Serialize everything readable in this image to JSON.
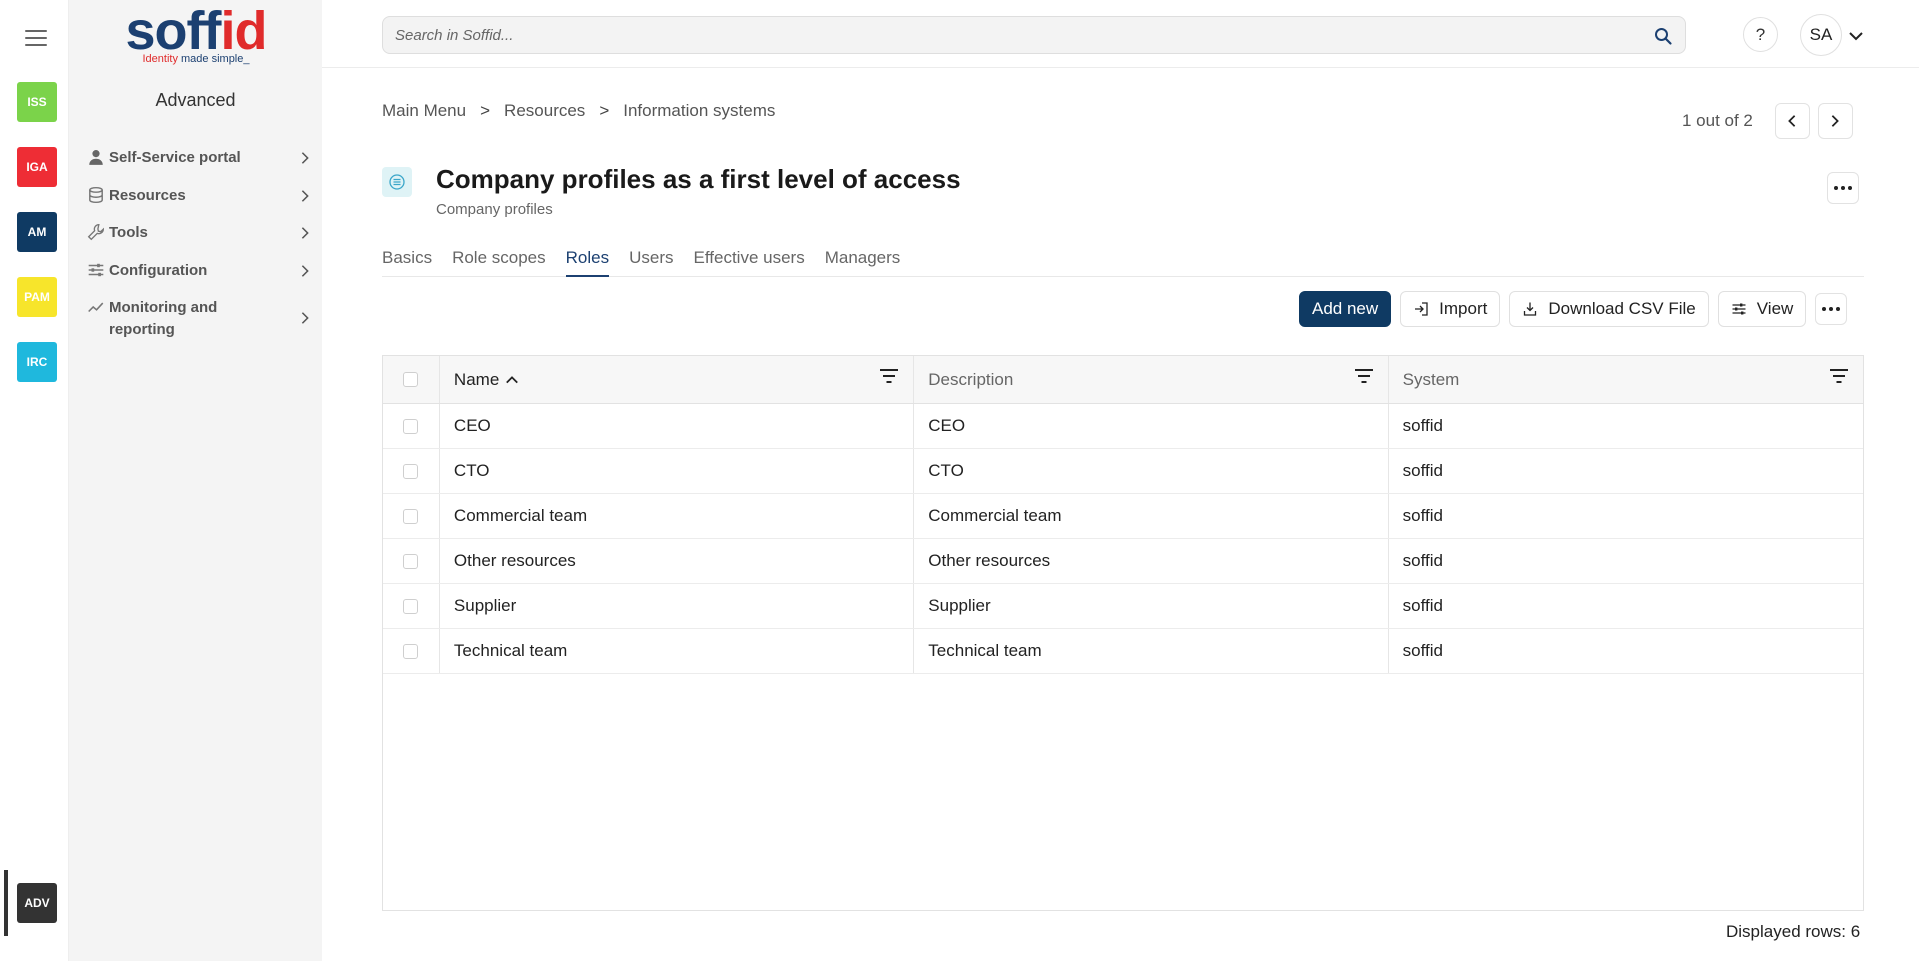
{
  "rail": {
    "apps": [
      {
        "label": "ISS",
        "color": "#7bd34a"
      },
      {
        "label": "IGA",
        "color": "#ee2d35"
      },
      {
        "label": "AM",
        "color": "#0f3a63"
      },
      {
        "label": "PAM",
        "color": "#f7e52b"
      },
      {
        "label": "IRC",
        "color": "#1fb8dd"
      }
    ],
    "active_app": {
      "label": "ADV",
      "color": "#333333"
    }
  },
  "sidebar": {
    "logo_word_a": "soff",
    "logo_word_b": "id",
    "logo_tag_a": "Identity",
    "logo_tag_b": " made simple_",
    "title": "Advanced",
    "items": [
      {
        "label": "Self-Service portal",
        "icon": "person-icon"
      },
      {
        "label": "Resources",
        "icon": "database-icon"
      },
      {
        "label": "Tools",
        "icon": "wrench-icon"
      },
      {
        "label": "Configuration",
        "icon": "sliders-icon"
      },
      {
        "label": "Monitoring and reporting",
        "icon": "chart-line-icon"
      }
    ]
  },
  "topbar": {
    "search_placeholder": "Search in Soffid...",
    "help_label": "?",
    "user_initials": "SA"
  },
  "breadcrumb": [
    "Main Menu",
    "Resources",
    "Information systems"
  ],
  "breadcrumb_sep": ">",
  "pager": {
    "text": "1 out of 2"
  },
  "page": {
    "title": "Company profiles as a first level of access",
    "subtitle": "Company profiles"
  },
  "tabs": [
    "Basics",
    "Role scopes",
    "Roles",
    "Users",
    "Effective users",
    "Managers"
  ],
  "active_tab": "Roles",
  "toolbar": {
    "add_new": "Add new",
    "import": "Import",
    "download_csv": "Download CSV File",
    "view": "View"
  },
  "table": {
    "columns": [
      "Name",
      "Description",
      "System"
    ],
    "rows": [
      [
        "CEO",
        "CEO",
        "soffid"
      ],
      [
        "CTO",
        "CTO",
        "soffid"
      ],
      [
        "Commercial team",
        "Commercial team",
        "soffid"
      ],
      [
        "Other resources",
        "Other resources",
        "soffid"
      ],
      [
        "Supplier",
        "Supplier",
        "soffid"
      ],
      [
        "Technical team",
        "Technical team",
        "soffid"
      ]
    ]
  },
  "footer": {
    "displayed_rows": "Displayed rows: 6"
  }
}
